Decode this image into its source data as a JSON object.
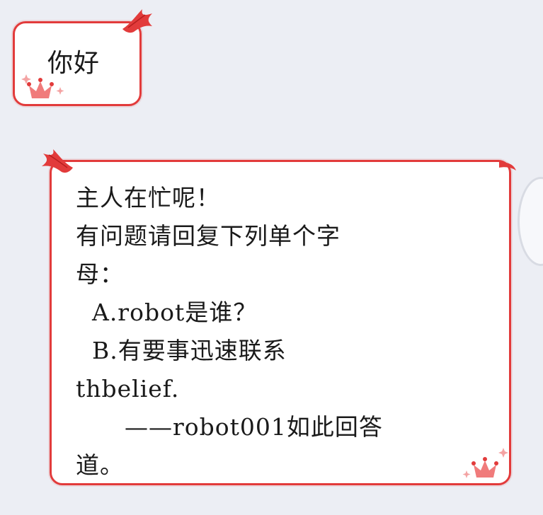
{
  "colors": {
    "background": "#eceef4",
    "bubble_fill": "#ffffff",
    "accent_red": "#e23b3b",
    "text": "#1a1a1a"
  },
  "messages": [
    {
      "text": "你好"
    },
    {
      "text": "主人在忙呢！\n有问题请回复下列单个字\n母：\n  A.robot是谁？\n  B.有要事迅速联系\nthbelief.\n      ——robot001如此回答\n道。"
    }
  ],
  "icons": {
    "bubble_corner_left": "red-feather-icon",
    "bubble_corner_right": "red-feather-icon",
    "sparkle_crown": "crown-sparkle-icon"
  }
}
